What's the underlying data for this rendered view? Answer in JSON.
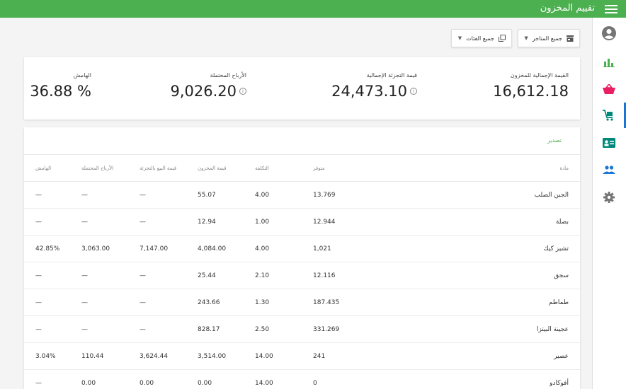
{
  "header": {
    "title": "تقييم المخزون",
    "menu_icon": "menu-icon"
  },
  "filters": {
    "stores": "جميع المتاجر",
    "categories": "جميع الفئات"
  },
  "summary": [
    {
      "label": "القيمة الإجمالية للمخزون",
      "value": "16,612.18",
      "info": false
    },
    {
      "label": "قيمة التجزئة الإجمالية",
      "value": "24,473.10",
      "info": true
    },
    {
      "label": "الأرباح المحتملة",
      "value": "9,026.20",
      "info": true
    },
    {
      "label": "الهامش",
      "value": "36.88 %",
      "info": false
    }
  ],
  "table": {
    "export_label": "تصدير",
    "headers": {
      "name": "مادة",
      "in_stock": "متوفر",
      "cost": "التكلفة",
      "inventory_value": "قيمة المخزون",
      "retail_value": "قيمة البيع بالتجزئة",
      "potential_profit": "الأرباح المحتملة",
      "margin": "الهامش"
    },
    "rows": [
      {
        "name": "الجبن الصلب",
        "in_stock": "13.769",
        "cost": "4.00",
        "inventory_value": "55.07",
        "retail_value": "—",
        "potential_profit": "—",
        "margin": "—"
      },
      {
        "name": "بصلة",
        "in_stock": "12.944",
        "cost": "1.00",
        "inventory_value": "12.94",
        "retail_value": "—",
        "potential_profit": "—",
        "margin": "—"
      },
      {
        "name": "تشيز كيك",
        "in_stock": "1,021",
        "cost": "4.00",
        "inventory_value": "4,084.00",
        "retail_value": "7,147.00",
        "potential_profit": "3,063.00",
        "margin": "42.85%"
      },
      {
        "name": "سجق",
        "in_stock": "12.116",
        "cost": "2.10",
        "inventory_value": "25.44",
        "retail_value": "—",
        "potential_profit": "—",
        "margin": "—"
      },
      {
        "name": "طماطم",
        "in_stock": "187.435",
        "cost": "1.30",
        "inventory_value": "243.66",
        "retail_value": "—",
        "potential_profit": "—",
        "margin": "—"
      },
      {
        "name": "عجينة البيتزا",
        "in_stock": "331.269",
        "cost": "2.50",
        "inventory_value": "828.17",
        "retail_value": "—",
        "potential_profit": "—",
        "margin": "—"
      },
      {
        "name": "عصير",
        "in_stock": "241",
        "cost": "14.00",
        "inventory_value": "3,514.00",
        "retail_value": "3,624.44",
        "potential_profit": "110.44",
        "margin": "3.04%"
      },
      {
        "name": "أفوكادو",
        "in_stock": "0",
        "cost": "14.00",
        "inventory_value": "0.00",
        "retail_value": "0.00",
        "potential_profit": "0.00",
        "margin": "—"
      }
    ]
  },
  "colors": {
    "topbar": "#4caf50",
    "accent": "#1976d2",
    "export": "#4caf50"
  }
}
